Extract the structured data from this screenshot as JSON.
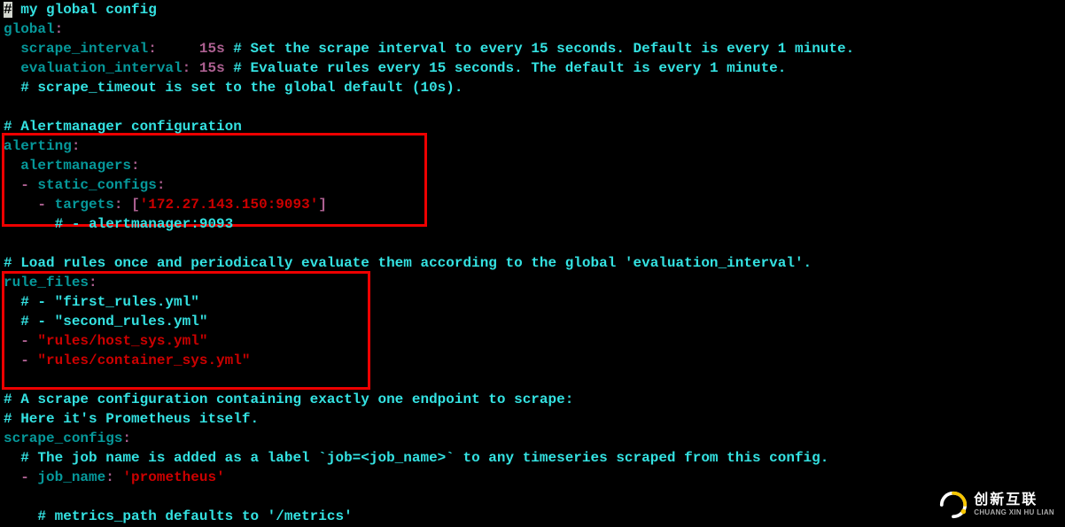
{
  "code": {
    "l1_comment": "# my global config",
    "l2_key": "global",
    "l3_key": "scrape_interval",
    "l3_val": "15s",
    "l3_comment": "# Set the scrape interval to every 15 seconds. Default is every 1 minute.",
    "l4_key": "evaluation_interval",
    "l4_val": "15s",
    "l4_comment": "# Evaluate rules every 15 seconds. The default is every 1 minute.",
    "l5_comment": "# scrape_timeout is set to the global default (10s).",
    "l7_comment": "# Alertmanager configuration",
    "l8_key": "alerting",
    "l9_key": "alertmanagers",
    "l10_key": "static_configs",
    "l11_key": "targets",
    "l11_str": "'172.27.143.150:9093'",
    "l12_comment": "# - alertmanager:9093",
    "l14_comment": "# Load rules once and periodically evaluate them according to the global 'evaluation_interval'.",
    "l15_key": "rule_files",
    "l16_comment": "# - \"first_rules.yml\"",
    "l17_comment": "# - \"second_rules.yml\"",
    "l18_str": "\"rules/host_sys.yml\"",
    "l19_str": "\"rules/container_sys.yml\"",
    "l21_comment": "# A scrape configuration containing exactly one endpoint to scrape:",
    "l22_comment": "# Here it's Prometheus itself.",
    "l23_key": "scrape_configs",
    "l24_comment": "# The job name is added as a label `job=<job_name>` to any timeseries scraped from this config.",
    "l25_key": "job_name",
    "l25_str": "'prometheus'",
    "l27_comment": "# metrics_path defaults to '/metrics'"
  },
  "logo": {
    "zh": "创新互联",
    "en": "CHUANG XIN HU LIAN"
  }
}
